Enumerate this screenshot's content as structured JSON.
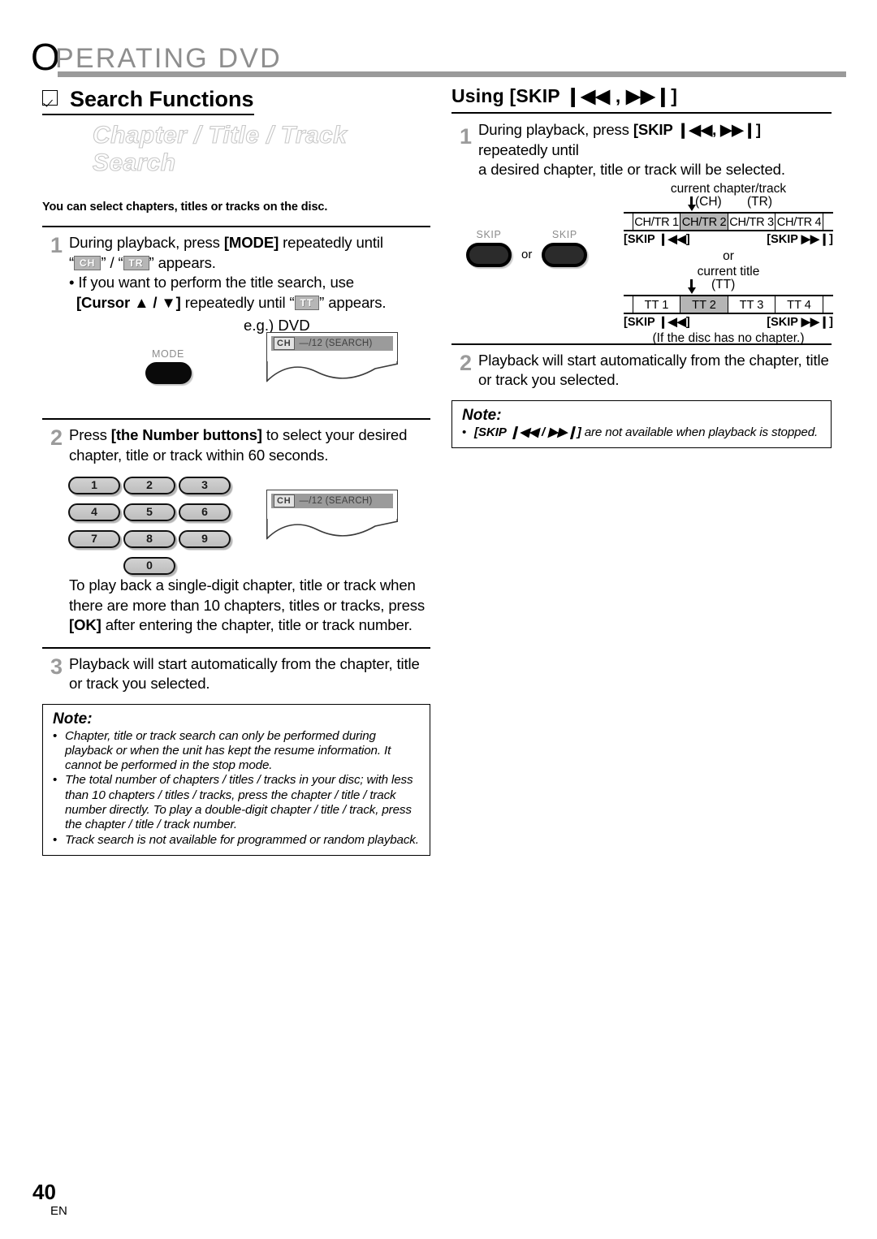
{
  "header": {
    "first_letter": "O",
    "rest": "PERATING  DVD"
  },
  "left": {
    "section_title": "Search Functions",
    "outline_title": "Chapter / Title / Track Search",
    "lead": "You can select chapters, titles or tracks on the disc.",
    "step1": {
      "num": "1",
      "line1_a": "During playback, press ",
      "line1_b": "[MODE]",
      "line1_c": " repeatedly until",
      "line2_pre": "“",
      "tag_ch": "CH",
      "line2_mid": "” / “",
      "tag_tr": "TR",
      "line2_post": "” appears.",
      "bullet_line1": "• If you want to perform the title search, use",
      "bullet_line2_a": "[Cursor ▲ / ▼]",
      "bullet_line2_b": " repeatedly until “",
      "tag_tt": "TT",
      "bullet_line2_c": "” appears.",
      "eg_label": "e.g.) DVD",
      "mode_button_label": "MODE",
      "display_tag": "CH",
      "display_text": "—/12 (SEARCH)"
    },
    "step2": {
      "num": "2",
      "line1_a": "Press ",
      "line1_b": "[the Number buttons]",
      "line1_c": " to select your desired",
      "line2": "chapter, title or track within 60 seconds.",
      "keys": [
        "1",
        "2",
        "3",
        "4",
        "5",
        "6",
        "7",
        "8",
        "9",
        "0"
      ],
      "display_tag": "CH",
      "display_text": "—/12 (SEARCH)",
      "para_line1": "To play back a single-digit chapter, title or track when",
      "para_line2": "there are more than 10 chapters, titles or tracks, press",
      "para_line3_a": "[OK]",
      "para_line3_b": " after entering the chapter, title or track number."
    },
    "step3": {
      "num": "3",
      "line1": "Playback will start automatically from the chapter, title",
      "line2": "or track you selected."
    },
    "note": {
      "title": "Note:",
      "items": [
        "Chapter, title or track search can only be performed during playback or when the unit has kept the resume information. It cannot be performed in the stop mode.",
        "The total number of chapters / titles / tracks in your disc; with less than 10 chapters / titles / tracks, press the chapter / title / track number directly. To play a double-digit chapter / title / track, press the chapter / title / track number.",
        "Track search is not available for programmed or random playback."
      ]
    }
  },
  "right": {
    "section_title": "Using [SKIP ❙◀◀ , ▶▶❙]",
    "step1": {
      "num": "1",
      "line1_a": "During playback, press ",
      "line1_b": "[SKIP ❙◀◀, ▶▶❙]",
      "line1_c": " repeatedly until",
      "line2": "a desired chapter, title or track will be selected.",
      "skip_button_label": "SKIP",
      "or_label": "or",
      "caption_top": "current chapter/track",
      "ch_paren": "(CH)",
      "tr_paren": "(TR)",
      "segments_ch": [
        "CH/TR 1",
        "CH/TR 2",
        "CH/TR 3",
        "CH/TR 4"
      ],
      "highlight_index_ch": 1,
      "skip_prev_label": "[SKIP ❙◀◀]",
      "skip_next_label": "[SKIP ▶▶❙]",
      "or_separator": "or",
      "caption_title": "current title",
      "tt_paren": "(TT)",
      "segments_tt": [
        "TT 1",
        "TT 2",
        "TT 3",
        "TT 4"
      ],
      "highlight_index_tt": 1,
      "no_chapter_note": "(If the disc has no chapter.)"
    },
    "step2": {
      "num": "2",
      "line1": "Playback will start automatically from the chapter, title",
      "line2": "or track you selected."
    },
    "note": {
      "title": "Note:",
      "item_bold": "[SKIP ❙◀◀ / ▶▶❙]",
      "item_rest": " are not available when playback is stopped."
    }
  },
  "footer": {
    "page_number": "40",
    "language": "EN"
  },
  "colors": {
    "header_gray": "#8e8e8e",
    "rule_gray": "#9a9a9a",
    "step_num_gray": "#9b9b9b",
    "highlight_gray": "#b5b5b5",
    "tag_gray": "#b6b6b6"
  }
}
